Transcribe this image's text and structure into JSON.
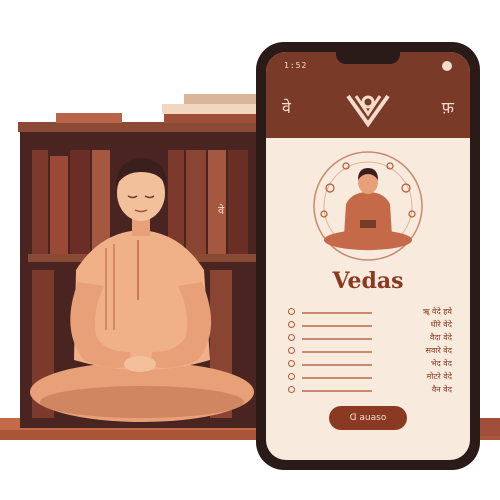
{
  "phone": {
    "status": {
      "time": "1:52"
    },
    "appbar": {
      "left_glyph": "वे",
      "right_glyph": "फ़"
    },
    "title": "Vedas",
    "verses": [
      {
        "text": "ॠ वेदे हवे"
      },
      {
        "text": "धीरे वेदे"
      },
      {
        "text": "वैदा वेदे"
      },
      {
        "text": "सवारे वेद"
      },
      {
        "text": "भेद वेद"
      },
      {
        "text": "मोटरे वेदे"
      },
      {
        "text": "वैन वेद"
      }
    ],
    "audio_button": {
      "label": "ᗡ auaso"
    }
  },
  "book_spine": {
    "glyph": "वे"
  },
  "colors": {
    "brand": "#7a3a28",
    "accent": "#b3583a",
    "background": "#f8ebdd",
    "skin": "#e8a078"
  }
}
